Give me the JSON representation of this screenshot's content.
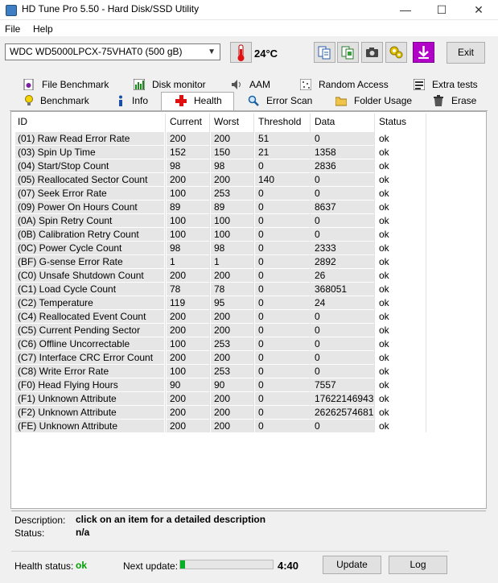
{
  "window": {
    "title": "HD Tune Pro 5.50 - Hard Disk/SSD Utility",
    "minimize": "—",
    "maximize": "☐",
    "close": "✕"
  },
  "menu": {
    "file": "File",
    "help": "Help"
  },
  "toolbar": {
    "drive": "WDC WD5000LPCX-75VHAT0 (500 gB)",
    "temperature": "24°C",
    "exit_label": "Exit",
    "icons": [
      "copy-info-icon",
      "copy-screen-icon",
      "camera-icon",
      "options-icon",
      "save-icon"
    ]
  },
  "tabs": {
    "row1": [
      "File Benchmark",
      "Disk monitor",
      "AAM",
      "Random Access",
      "Extra tests"
    ],
    "row2": [
      "Benchmark",
      "Info",
      "Health",
      "Error Scan",
      "Folder Usage",
      "Erase"
    ],
    "active": "Health"
  },
  "table": {
    "headers": [
      "ID",
      "Current",
      "Worst",
      "Threshold",
      "Data",
      "Status"
    ],
    "rows": [
      [
        "(01) Raw Read Error Rate",
        "200",
        "200",
        "51",
        "0",
        "ok"
      ],
      [
        "(03) Spin Up Time",
        "152",
        "150",
        "21",
        "1358",
        "ok"
      ],
      [
        "(04) Start/Stop Count",
        "98",
        "98",
        "0",
        "2836",
        "ok"
      ],
      [
        "(05) Reallocated Sector Count",
        "200",
        "200",
        "140",
        "0",
        "ok"
      ],
      [
        "(07) Seek Error Rate",
        "100",
        "253",
        "0",
        "0",
        "ok"
      ],
      [
        "(09) Power On Hours Count",
        "89",
        "89",
        "0",
        "8637",
        "ok"
      ],
      [
        "(0A) Spin Retry Count",
        "100",
        "100",
        "0",
        "0",
        "ok"
      ],
      [
        "(0B) Calibration Retry Count",
        "100",
        "100",
        "0",
        "0",
        "ok"
      ],
      [
        "(0C) Power Cycle Count",
        "98",
        "98",
        "0",
        "2333",
        "ok"
      ],
      [
        "(BF) G-sense Error Rate",
        "1",
        "1",
        "0",
        "2892",
        "ok"
      ],
      [
        "(C0) Unsafe Shutdown Count",
        "200",
        "200",
        "0",
        "26",
        "ok"
      ],
      [
        "(C1) Load Cycle Count",
        "78",
        "78",
        "0",
        "368051",
        "ok"
      ],
      [
        "(C2) Temperature",
        "119",
        "95",
        "0",
        "24",
        "ok"
      ],
      [
        "(C4) Reallocated Event Count",
        "200",
        "200",
        "0",
        "0",
        "ok"
      ],
      [
        "(C5) Current Pending Sector",
        "200",
        "200",
        "0",
        "0",
        "ok"
      ],
      [
        "(C6) Offline Uncorrectable",
        "100",
        "253",
        "0",
        "0",
        "ok"
      ],
      [
        "(C7) Interface CRC Error Count",
        "200",
        "200",
        "0",
        "0",
        "ok"
      ],
      [
        "(C8) Write Error Rate",
        "100",
        "253",
        "0",
        "0",
        "ok"
      ],
      [
        "(F0) Head Flying Hours",
        "90",
        "90",
        "0",
        "7557",
        "ok"
      ],
      [
        "(F1) Unknown Attribute",
        "200",
        "200",
        "0",
        "17622146943",
        "ok"
      ],
      [
        "(F2) Unknown Attribute",
        "200",
        "200",
        "0",
        "26262574681",
        "ok"
      ],
      [
        "(FE) Unknown Attribute",
        "200",
        "200",
        "0",
        "0",
        "ok"
      ]
    ]
  },
  "details": {
    "description_label": "Description:",
    "description_value": "click on an item for a detailed description",
    "status_label": "Status:",
    "status_value": "n/a"
  },
  "footer": {
    "health_label": "Health status:",
    "health_value": "ok",
    "health_color": "#00a000",
    "next_update_label": "Next update:",
    "progress": 0.05,
    "countdown": "4:40",
    "update_label": "Update",
    "log_label": "Log"
  }
}
